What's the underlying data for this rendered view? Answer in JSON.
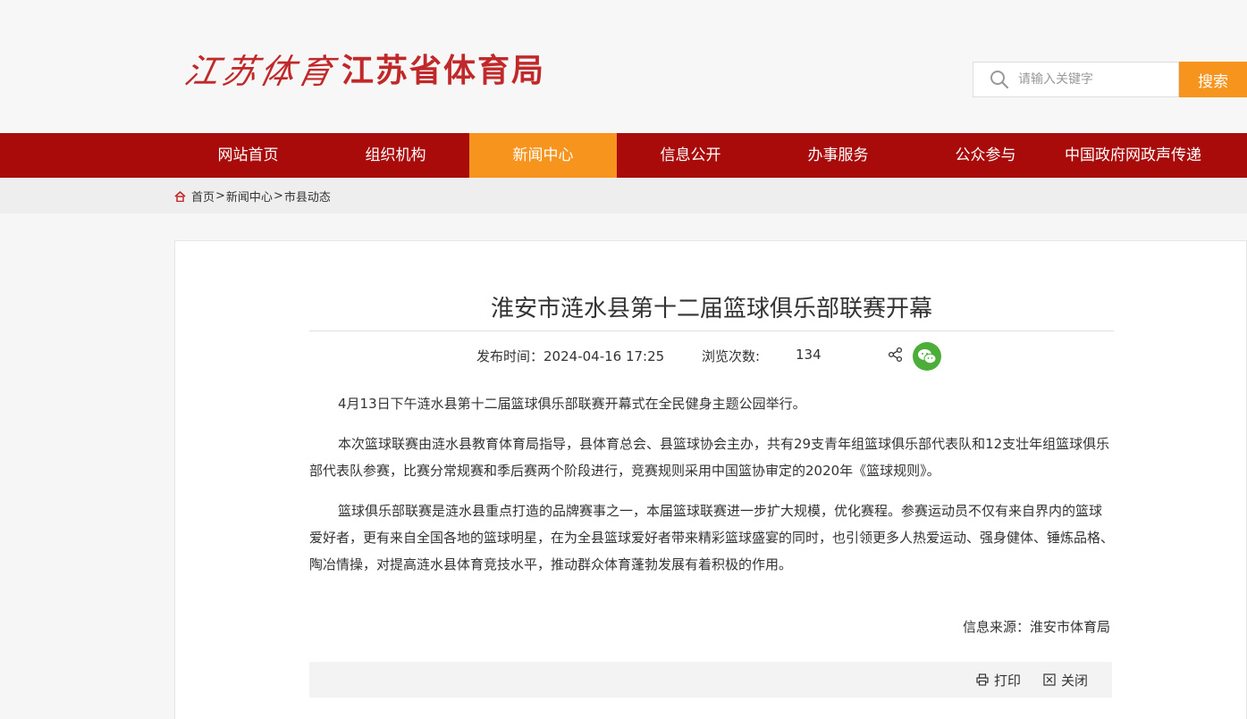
{
  "header": {
    "logo_calligraphy": "江苏体育",
    "logo_text": "江苏省体育局"
  },
  "search": {
    "placeholder": "请输入关键字",
    "button_label": "搜索"
  },
  "nav": {
    "items": [
      "网站首页",
      "组织机构",
      "新闻中心",
      "信息公开",
      "办事服务",
      "公众参与",
      "中国政府网政声传递"
    ],
    "active": "新闻中心"
  },
  "breadcrumb": {
    "home": "首页",
    "level1": "新闻中心",
    "level2": "市县动态",
    "separator": ">"
  },
  "article": {
    "title": "淮安市涟水县第十二届篮球俱乐部联赛开幕",
    "publish_label": "发布时间：",
    "publish_time": "2024-04-16 17:25",
    "views_label": "浏览次数:",
    "views": "134",
    "paragraphs": [
      "4月13日下午涟水县第十二届篮球俱乐部联赛开幕式在全民健身主题公园举行。",
      "本次篮球联赛由涟水县教育体育局指导，县体育总会、县篮球协会主办，共有29支青年组篮球俱乐部代表队和12支壮年组篮球俱乐部代表队参赛，比赛分常规赛和季后赛两个阶段进行，竞赛规则采用中国篮协审定的2020年《篮球规则》。",
      "篮球俱乐部联赛是涟水县重点打造的品牌赛事之一，本届篮球联赛进一步扩大规模，优化赛程。参赛运动员不仅有来自界内的篮球爱好者，更有来自全国各地的篮球明星，在为全县篮球爱好者带来精彩篮球盛宴的同时，也引领更多人热爱运动、强身健体、锤炼品格、陶冶情操，对提高涟水县体育竞技水平，推动群众体育蓬勃发展有着积极的作用。"
    ],
    "source": "信息来源：淮安市体育局"
  },
  "toolbar": {
    "print_label": "打印",
    "close_label": "关闭"
  },
  "colors": {
    "nav_red": "#a90b0b",
    "accent_orange": "#f7941e",
    "logo_red": "#c0282a",
    "wechat_green": "#4cae38"
  }
}
